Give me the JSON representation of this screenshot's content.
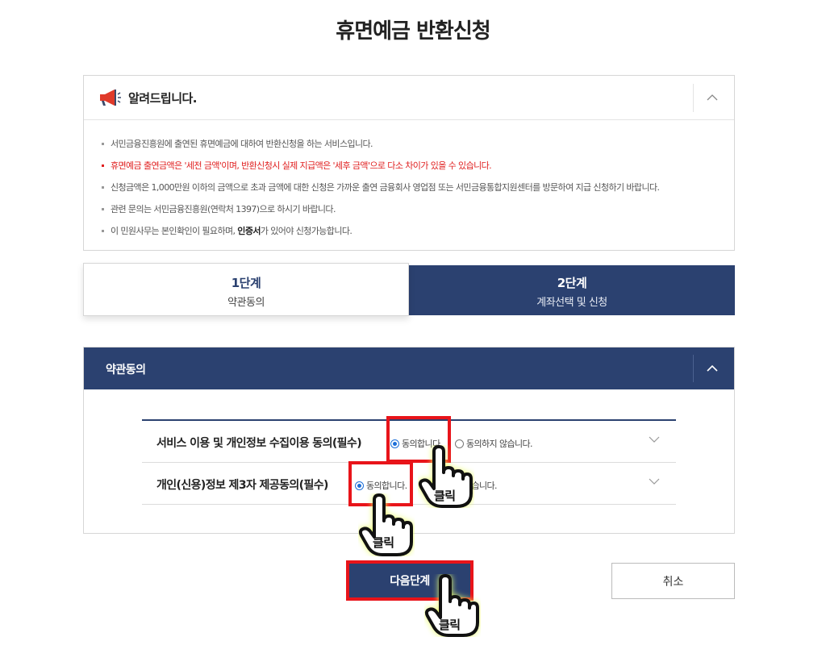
{
  "page": {
    "title": "휴면예금 반환신청"
  },
  "notice": {
    "title": "알려드립니다.",
    "items": [
      "서민금융진흥원에 출연된 휴면예금에 대하여 반환신청을 하는 서비스입니다.",
      "휴면예금 출연금액은 '세전 금액'이며, 반환신청시 실제 지급액은 '세후 금액'으로 다소 차이가 있을 수 있습니다.",
      "신청금액은 1,000만원 이하의 금액으로 초과 금액에 대한 신청은 가까운 출연 금융회사 영업점 또는 서민금융통합지원센터를 방문하여 지급 신청하기 바랍니다.",
      "관련 문의는 서민금융진흥원(연락처 1397)으로 하시기 바랍니다."
    ],
    "last_item_pre": "이 민원사무는 본인확인이 필요하며, ",
    "last_item_bold": "인증서",
    "last_item_post": "가 있어야 신청가능합니다."
  },
  "steps": [
    {
      "num": "1단계",
      "name": "약관동의"
    },
    {
      "num": "2단계",
      "name": "계좌선택 및 신청"
    }
  ],
  "terms": {
    "title": "약관동의",
    "rows": [
      {
        "label": "서비스 이용 및 개인정보 수집이용 동의(필수)",
        "agree": "동의합니다.",
        "disagree": "동의하지 않습니다.",
        "selected": "agree"
      },
      {
        "label": "개인(신용)정보 제3자 제공동의(필수)",
        "agree": "동의합니다.",
        "disagree": "동의하지 않습니다.",
        "selected": "agree"
      }
    ]
  },
  "buttons": {
    "next": "다음단계",
    "cancel": "취소"
  },
  "annotations": {
    "click_label": "클릭"
  },
  "colors": {
    "navy": "#2b4170",
    "highlight": "#e8141a",
    "notice_red": "#e02020",
    "radio_blue": "#1d6fd8"
  },
  "icons": [
    "megaphone-icon",
    "chevron-up-icon",
    "chevron-down-icon",
    "pointing-hand-icon"
  ]
}
